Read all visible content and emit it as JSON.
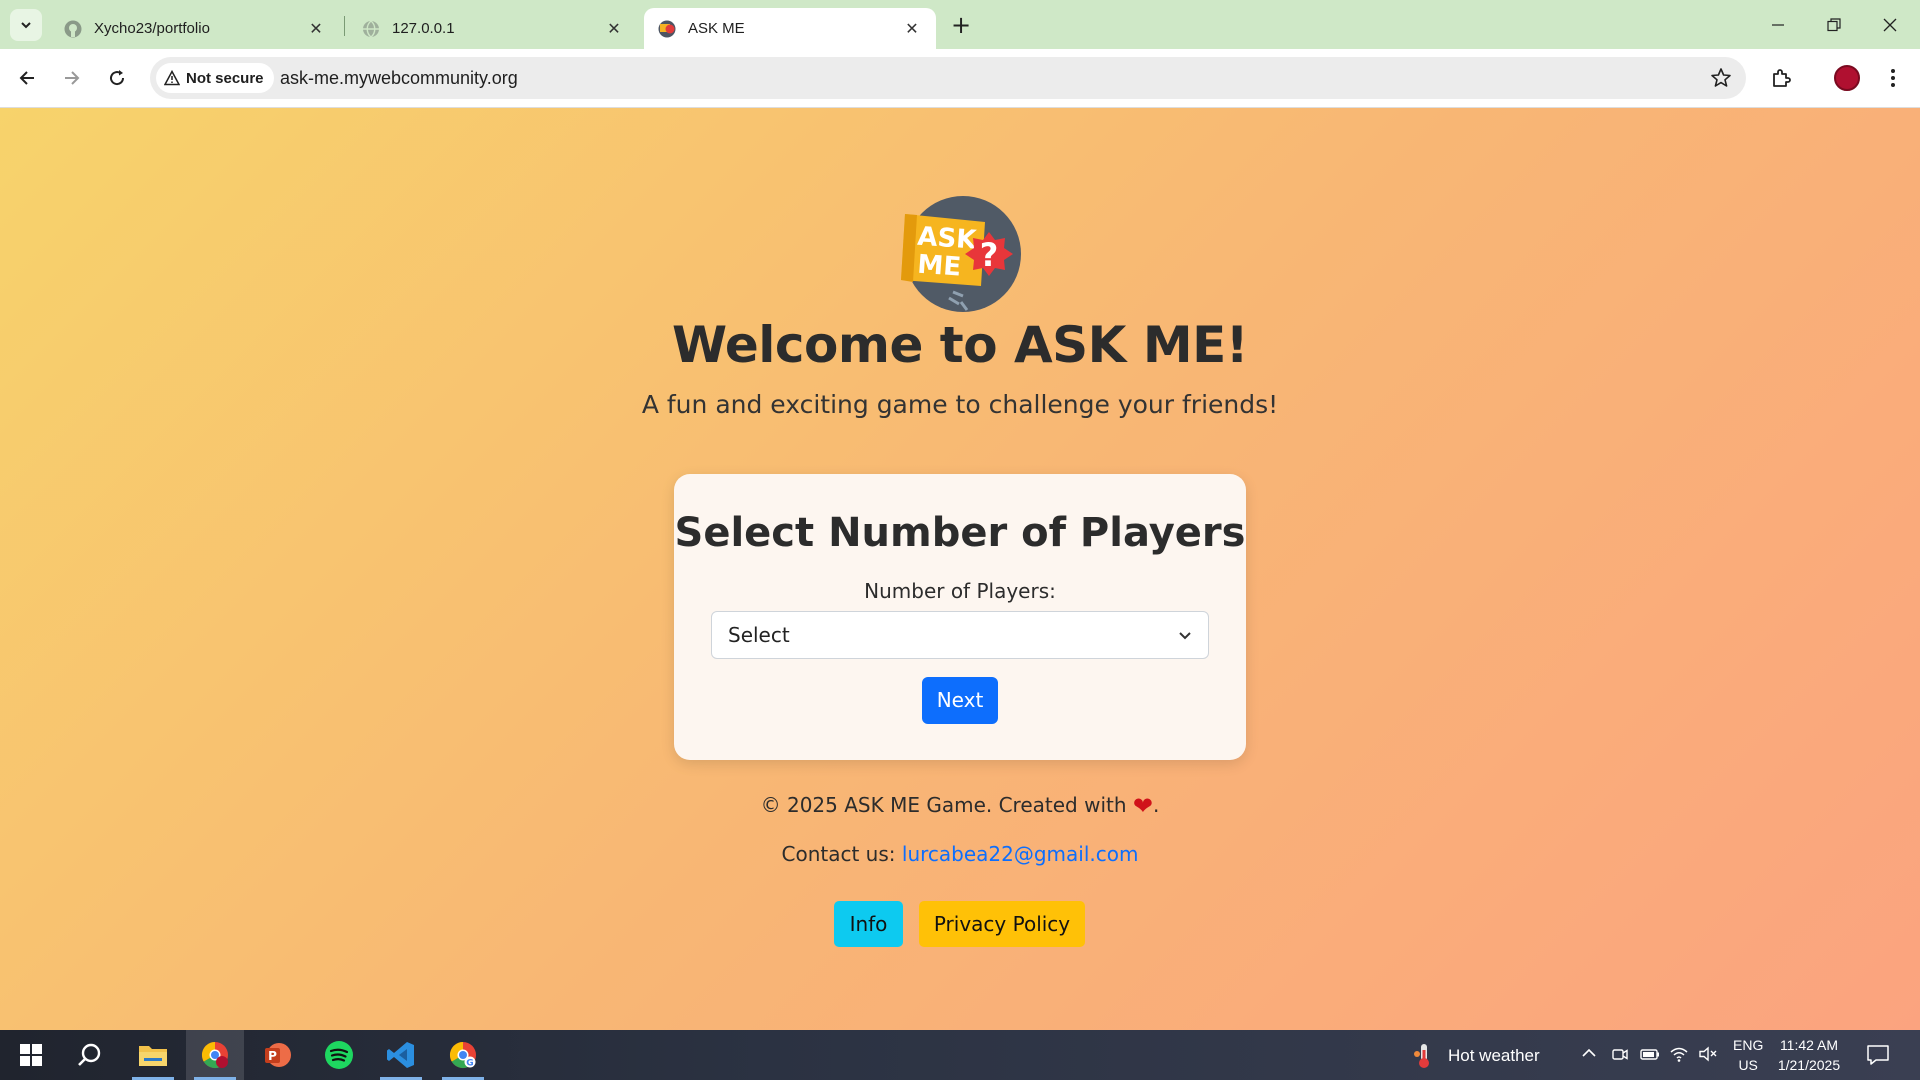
{
  "browser": {
    "tabs": [
      {
        "title": "Xycho23/portfolio",
        "favicon": "github-icon",
        "active": false
      },
      {
        "title": "127.0.0.1",
        "favicon": "globe-icon",
        "active": false
      },
      {
        "title": "ASK ME",
        "favicon": "ask-me-favicon",
        "active": true
      }
    ],
    "security_label": "Not secure",
    "url": "ask-me.mywebcommunity.org"
  },
  "page": {
    "logo_text_line1": "ASK",
    "logo_text_line2": "ME",
    "title": "Welcome to ASK ME!",
    "subtitle": "A fun and exciting game to challenge your friends!",
    "card": {
      "title": "Select Number of Players",
      "label": "Number of Players:",
      "select_value": "Select",
      "next_label": "Next"
    },
    "footer": {
      "copyright_prefix": "© 2025 ASK ME Game. Created with",
      "copyright_suffix": ".",
      "contact_prefix": "Contact us:",
      "contact_email": "lurcabea22@gmail.com",
      "info_label": "Info",
      "privacy_label": "Privacy Policy"
    }
  },
  "taskbar": {
    "weather": "Hot weather",
    "lang_line1": "ENG",
    "lang_line2": "US",
    "time": "11:42 AM",
    "date": "1/21/2025"
  },
  "colors": {
    "primary_button": "#0d6efd",
    "info_button": "#0dcaf0",
    "privacy_button": "#ffc107",
    "heart": "#d0121a"
  }
}
